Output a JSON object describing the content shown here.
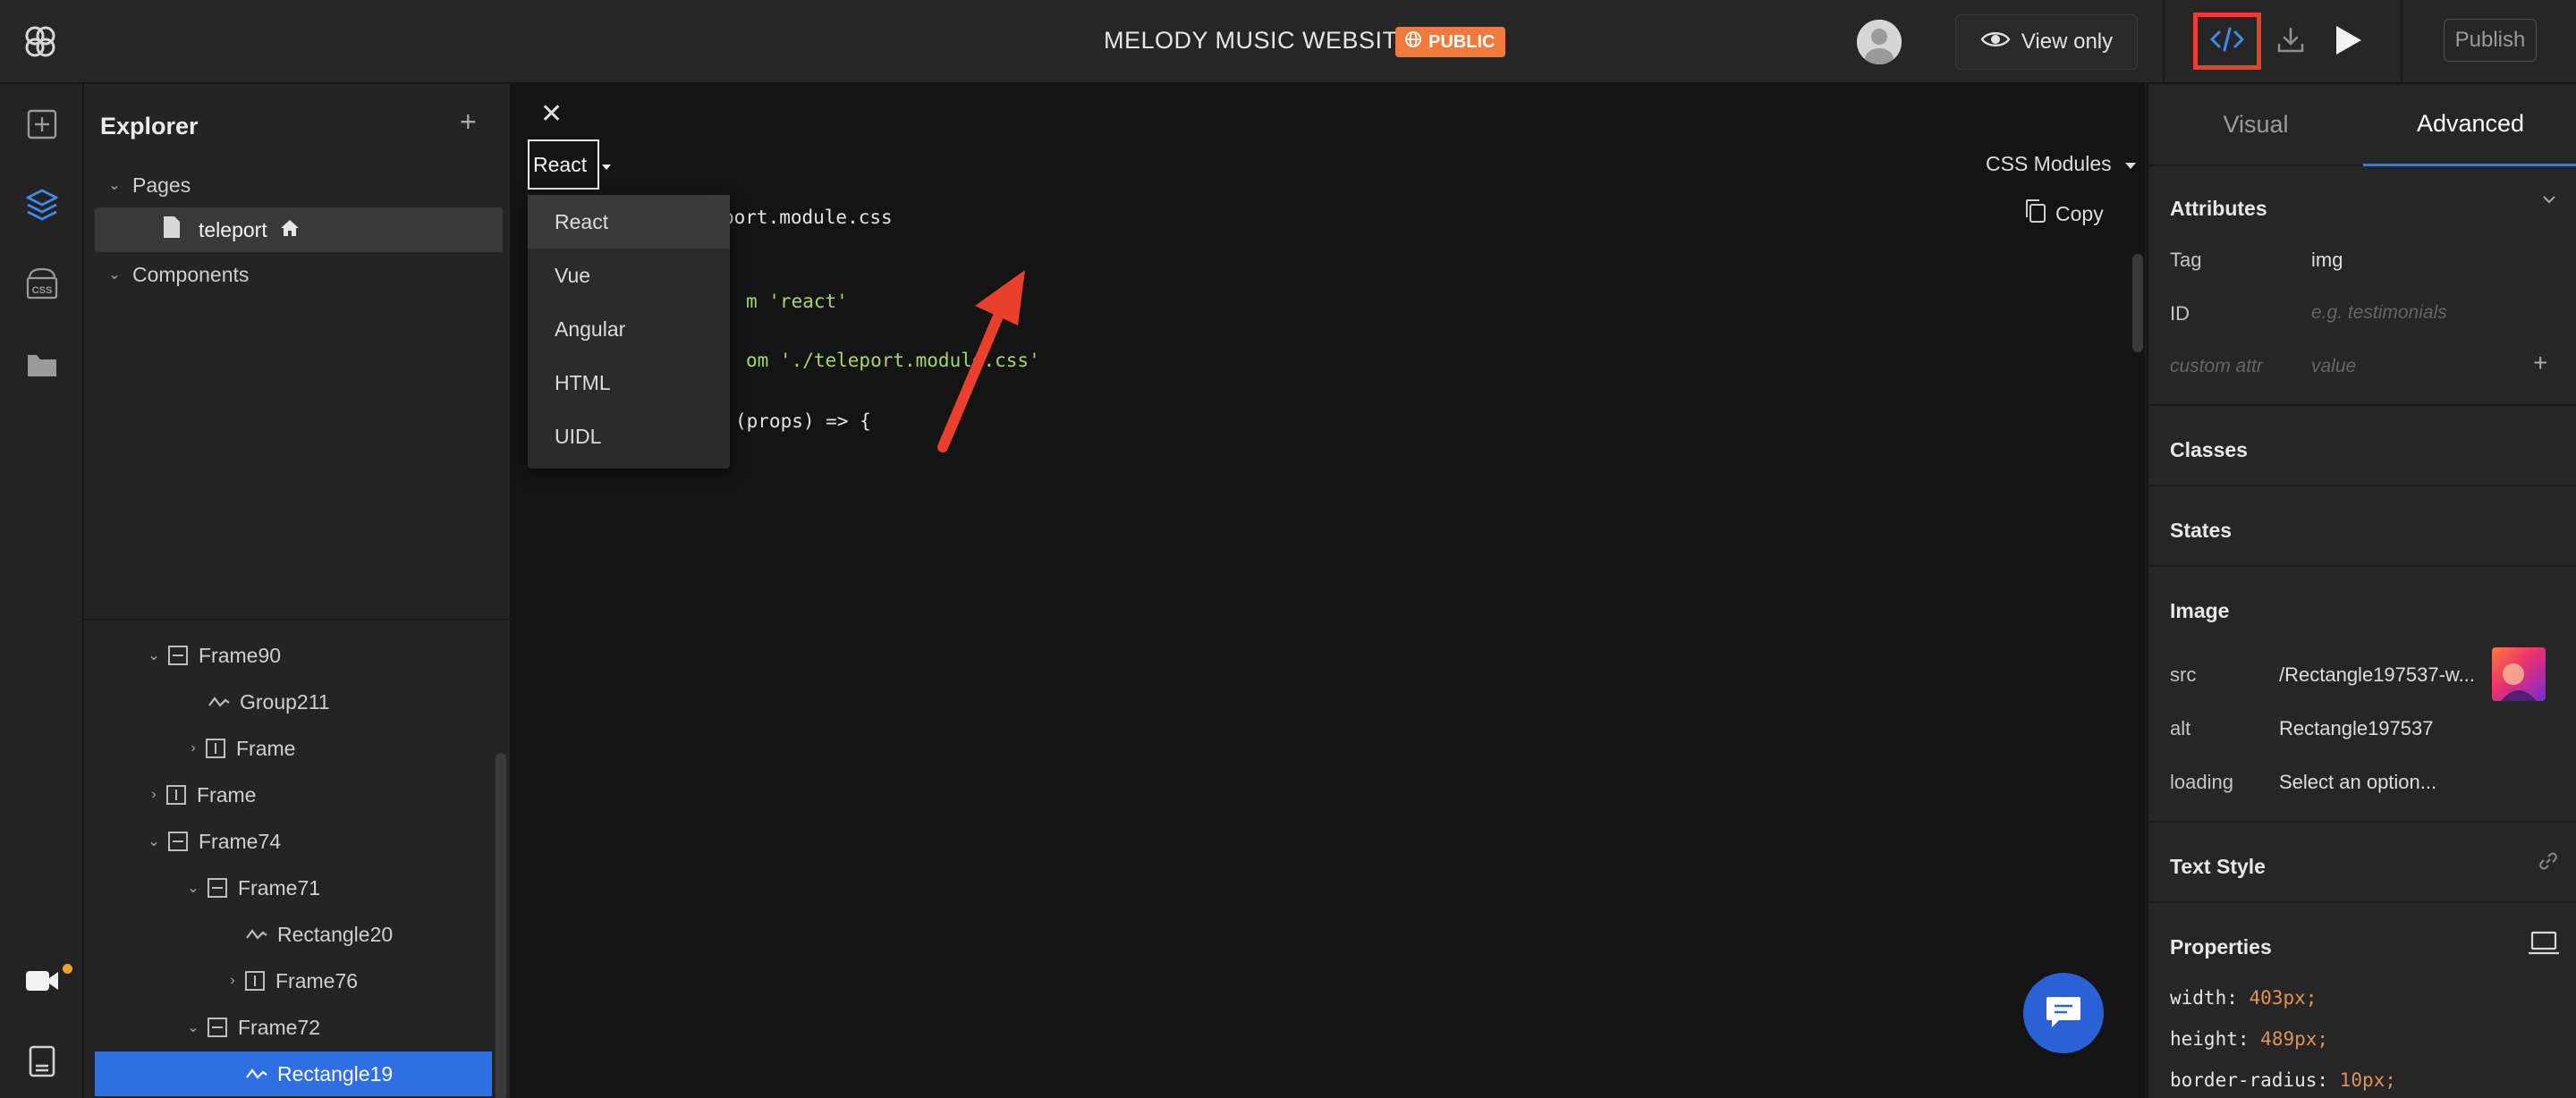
{
  "header": {
    "project_title": "MELODY MUSIC WEBSITE",
    "public_badge": "PUBLIC",
    "view_only_label": "View only",
    "publish_label": "Publish"
  },
  "explorer": {
    "title": "Explorer",
    "add_label": "+",
    "pages_label": "Pages",
    "page_teleport": "teleport",
    "components_label": "Components",
    "layers": [
      "Frame90",
      "Group211",
      "Frame",
      "Frame",
      "Frame74",
      "Frame71",
      "Rectangle20",
      "Frame76",
      "Frame72",
      "Rectangle19"
    ]
  },
  "code_panel": {
    "close_label": "✕",
    "framework_selected": "React",
    "framework_options": [
      "React",
      "Vue",
      "Angular",
      "HTML",
      "UIDL"
    ],
    "css_mode": "CSS Modules",
    "copy_label": "Copy",
    "line_import_css": "port.module.css",
    "line_import_react": "m 'react'",
    "line_import_styles": "om './teleport.module.css'",
    "line_component": "(props) => {"
  },
  "right_panel": {
    "tabs": [
      "Visual",
      "Advanced"
    ],
    "attributes_label": "Attributes",
    "tag_label": "Tag",
    "tag_value": "img",
    "id_label": "ID",
    "id_placeholder": "e.g. testimonials",
    "custom_attr_placeholder": "custom attr",
    "value_placeholder": "value",
    "add_label": "+",
    "classes_label": "Classes",
    "states_label": "States",
    "image_label": "Image",
    "src_label": "src",
    "src_value": "/Rectangle197537-w...",
    "alt_label": "alt",
    "alt_value": "Rectangle197537",
    "loading_label": "loading",
    "loading_value": "Select an option...",
    "text_style_label": "Text Style",
    "properties_label": "Properties",
    "css_properties": [
      {
        "key": "width:",
        "value": "403px;"
      },
      {
        "key": "height:",
        "value": "489px;"
      },
      {
        "key": "border-radius:",
        "value": "10px;"
      }
    ]
  },
  "colors": {
    "accent_blue": "#2f6fe4",
    "public_orange": "#f07a3b",
    "annotation_red": "#e8402c"
  }
}
